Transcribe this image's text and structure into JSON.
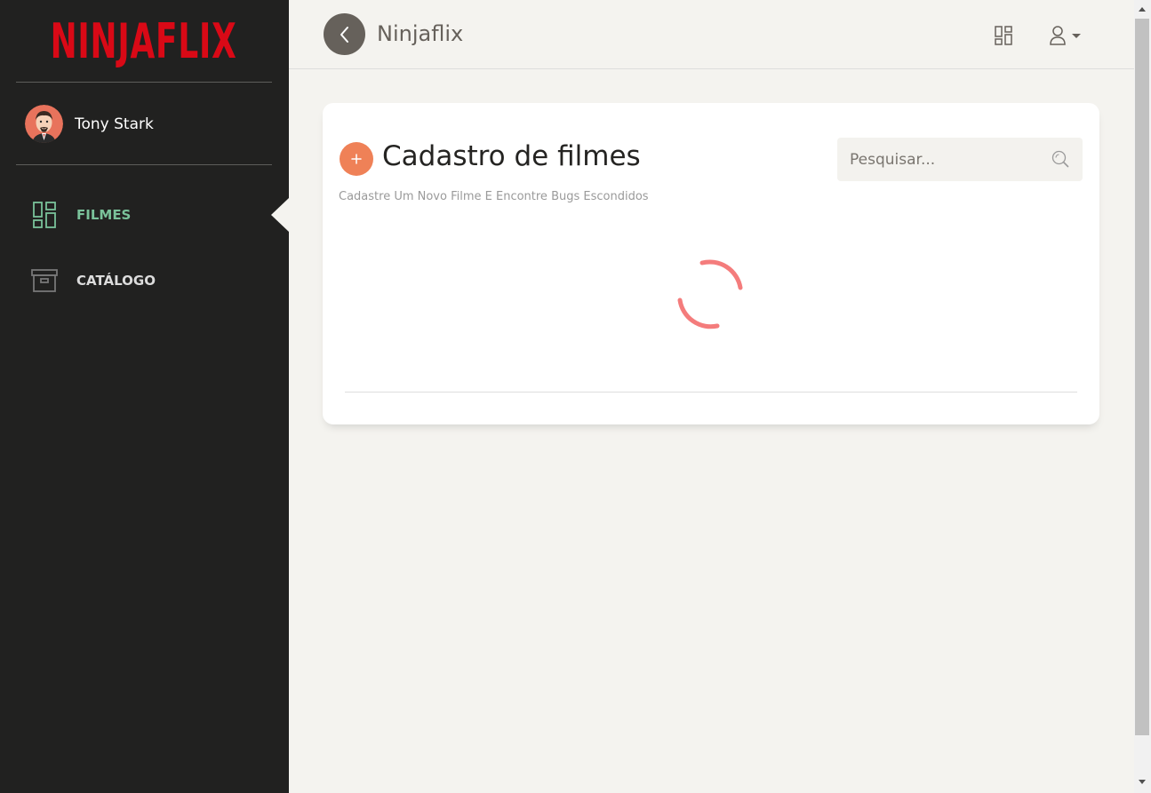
{
  "sidebar": {
    "logo_text": "NINJAFLIX",
    "user": {
      "name": "Tony Stark"
    },
    "nav": [
      {
        "label": "FILMES",
        "icon": "dashboard-grid-icon",
        "active": true
      },
      {
        "label": "CATÁLOGO",
        "icon": "archive-box-icon",
        "active": false
      }
    ]
  },
  "topbar": {
    "brand": "Ninjaflix",
    "back_icon": "chevron-left-icon",
    "apps_icon": "dashboard-grid-icon",
    "user_icon": "user-icon"
  },
  "card": {
    "title": "Cadastro de filmes",
    "subtitle": "Cadastre Um Novo Filme E Encontre Bugs Escondidos",
    "search": {
      "placeholder": "Pesquisar...",
      "value": ""
    },
    "loading": true
  },
  "colors": {
    "sidebar_bg": "#212120",
    "logo_red": "#d90916",
    "active_green": "#7ac29a",
    "accent_orange": "#ef8157",
    "spinner_red": "#f47c7c"
  }
}
